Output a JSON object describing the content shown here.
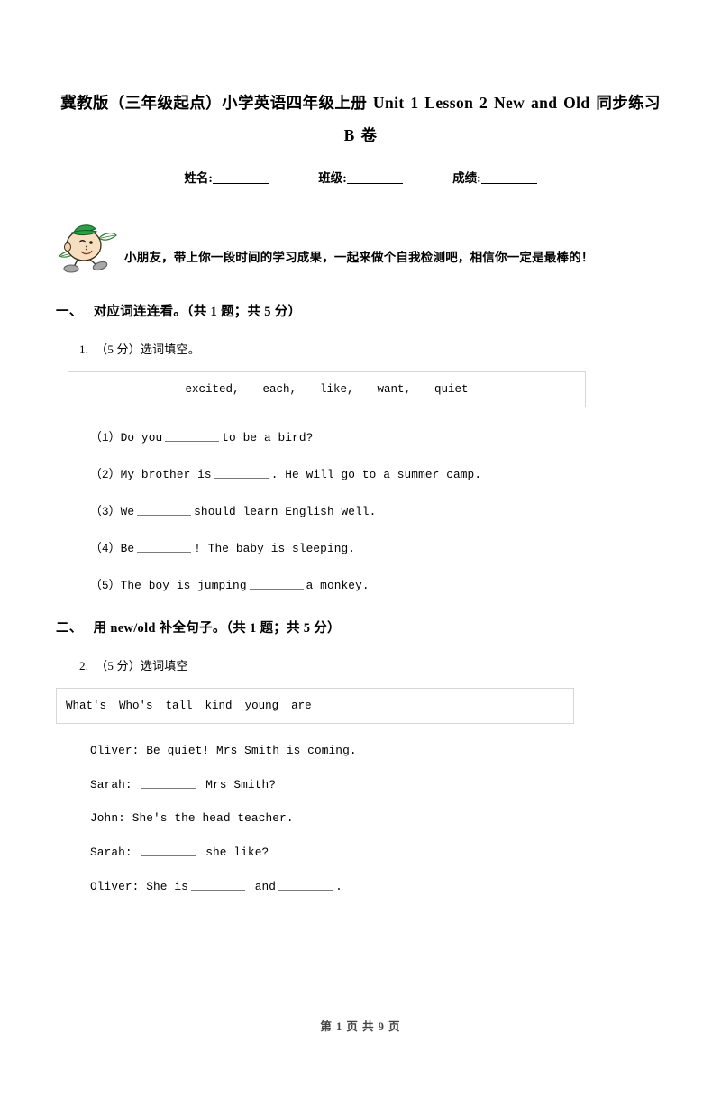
{
  "document": {
    "title": "冀教版（三年级起点）小学英语四年级上册 Unit 1 Lesson 2 New and Old 同步练习 B 卷",
    "intro_text": "小朋友，带上你一段时间的学习成果，一起来做个自我检测吧，相信你一定是最棒的！",
    "mascot_icon": "cartoon-student-mascot-icon"
  },
  "student_info": {
    "name_label": "姓名:",
    "class_label": "班级:",
    "score_label": "成绩:"
  },
  "sections": [
    {
      "number": "一、",
      "heading": "对应词连连看。（共 1 题；共 5 分）",
      "question": {
        "number": "1.",
        "prompt": "（5 分）选词填空。",
        "wordbank": [
          "excited,",
          "each,",
          "like,",
          "want,",
          "quiet"
        ],
        "items": [
          {
            "label": "（1）",
            "before": "Do you",
            "after": "to be a bird?"
          },
          {
            "label": "（2）",
            "before": "My brother is",
            "after": ". He will go to a summer camp."
          },
          {
            "label": "（3）",
            "before": "We",
            "after": "should learn English well."
          },
          {
            "label": "（4）",
            "before": "Be",
            "after": "! The baby is sleeping."
          },
          {
            "label": "（5）",
            "before": "The boy is jumping",
            "after": "a monkey."
          }
        ]
      }
    },
    {
      "number": "二、",
      "heading": "用 new/old 补全句子。（共 1 题；共 5 分）",
      "question": {
        "number": "2.",
        "prompt": "（5 分）选词填空",
        "wordbank": [
          "What's",
          "Who's",
          "tall",
          "kind",
          "young",
          "are"
        ],
        "dialogue": [
          {
            "speaker": "Oliver:",
            "before": "Be quiet! Mrs Smith is coming.",
            "blanks": 0,
            "after": ""
          },
          {
            "speaker": "Sarah:",
            "before": "",
            "blanks": 1,
            "after": "Mrs Smith?"
          },
          {
            "speaker": "John:",
            "before": "She's the head teacher.",
            "blanks": 0,
            "after": ""
          },
          {
            "speaker": "Sarah:",
            "before": "",
            "blanks": 1,
            "after": "she like?"
          },
          {
            "speaker": "Oliver:",
            "before": "She is",
            "blanks": 2,
            "middle": "and",
            "after": "."
          }
        ]
      }
    }
  ],
  "footer": {
    "text": "第 1 页 共 9 页"
  },
  "colors": {
    "text": "#000000",
    "box_border": "#d6d6d6",
    "blank_line": "#7a7a7a",
    "footer_text": "#444444",
    "mascot_hat": "#1f8a3b",
    "mascot_body": "#f2d7b0",
    "mascot_shoe": "#9a9a9a"
  }
}
